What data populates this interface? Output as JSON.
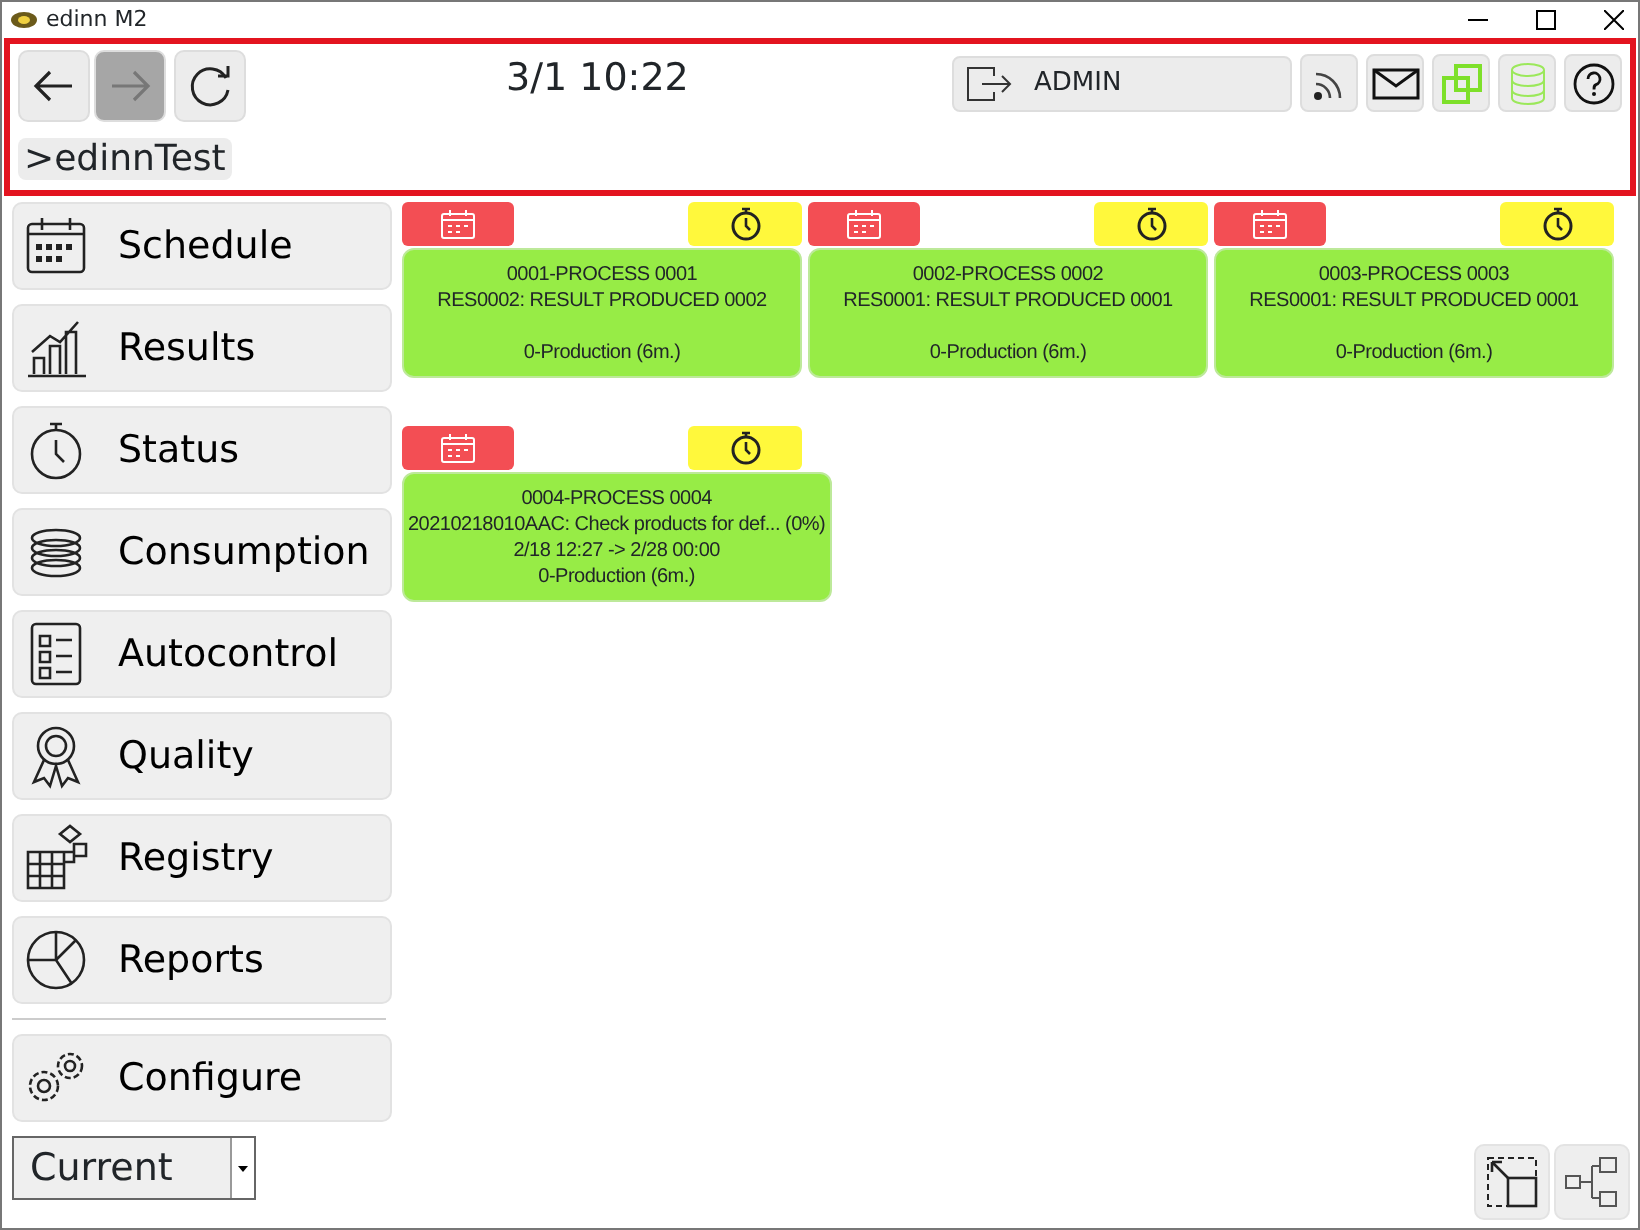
{
  "window": {
    "title": "edinn M2"
  },
  "header": {
    "nav_buttons": [
      {
        "disabled": false
      },
      {
        "disabled": true
      }
    ],
    "clock": "3/1 10:22",
    "user": "ADMIN",
    "breadcrumb": ">edinnTest"
  },
  "sidebar": {
    "items": [
      {
        "label": "Schedule"
      },
      {
        "label": "Results"
      },
      {
        "label": "Status"
      },
      {
        "label": "Consumption"
      },
      {
        "label": "Autocontrol"
      },
      {
        "label": "Quality"
      },
      {
        "label": "Registry"
      },
      {
        "label": "Reports"
      }
    ],
    "configure": {
      "label": "Configure"
    },
    "selector": {
      "value": "Current"
    }
  },
  "card_rows": [
    {
      "cards": [
        {
          "title": "0001-PROCESS 0001",
          "result": "RES0002: RESULT PRODUCED 0002",
          "shift": "0-Production (6m.)"
        },
        {
          "title": "0002-PROCESS 0002",
          "result": "RES0001: RESULT PRODUCED 0001",
          "shift": "0-Production (6m.)"
        },
        {
          "title": "0003-PROCESS 0003",
          "result": "RES0001: RESULT PRODUCED 0001",
          "shift": "0-Production (6m.)"
        }
      ]
    },
    {
      "cards": [
        {
          "title": "0004-PROCESS 0004",
          "result": "20210218010AAC: Check products for def... (0%)",
          "dates": "2/18 12:27 -> 2/28 00:00",
          "shift": "0-Production (6m.)"
        }
      ]
    }
  ]
}
